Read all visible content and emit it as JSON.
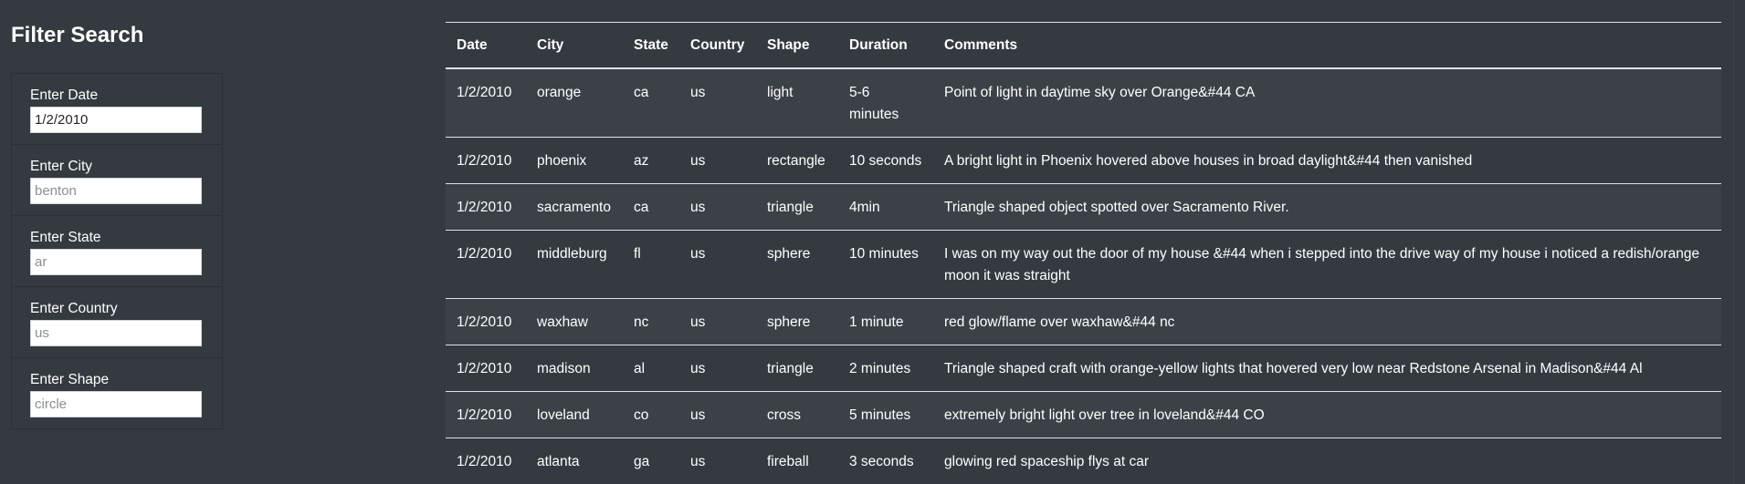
{
  "sidebar": {
    "title": "Filter Search",
    "filters": [
      {
        "label": "Enter Date",
        "value": "1/2/2010",
        "placeholder": ""
      },
      {
        "label": "Enter City",
        "value": "",
        "placeholder": "benton"
      },
      {
        "label": "Enter State",
        "value": "",
        "placeholder": "ar"
      },
      {
        "label": "Enter Country",
        "value": "",
        "placeholder": "us"
      },
      {
        "label": "Enter Shape",
        "value": "",
        "placeholder": "circle"
      }
    ]
  },
  "table": {
    "headers": [
      "Date",
      "City",
      "State",
      "Country",
      "Shape",
      "Duration",
      "Comments"
    ],
    "rows": [
      [
        "1/2/2010",
        "orange",
        "ca",
        "us",
        "light",
        "5-6 minutes",
        "Point of light in daytime sky over Orange&#44 CA"
      ],
      [
        "1/2/2010",
        "phoenix",
        "az",
        "us",
        "rectangle",
        "10 seconds",
        "A bright light in Phoenix hovered above houses in broad daylight&#44 then vanished"
      ],
      [
        "1/2/2010",
        "sacramento",
        "ca",
        "us",
        "triangle",
        "4min",
        "Triangle shaped object spotted over Sacramento River."
      ],
      [
        "1/2/2010",
        "middleburg",
        "fl",
        "us",
        "sphere",
        "10 minutes",
        "I was on my way out the door of my house &#44 when i stepped into the drive way of my house i noticed a redish/orange moon it was straight"
      ],
      [
        "1/2/2010",
        "waxhaw",
        "nc",
        "us",
        "sphere",
        "1 minute",
        "red glow/flame over waxhaw&#44 nc"
      ],
      [
        "1/2/2010",
        "madison",
        "al",
        "us",
        "triangle",
        "2 minutes",
        "Triangle shaped craft with orange-yellow lights that hovered very low near Redstone Arsenal in Madison&#44 Al"
      ],
      [
        "1/2/2010",
        "loveland",
        "co",
        "us",
        "cross",
        "5 minutes",
        "extremely bright light over tree in loveland&#44 CO"
      ],
      [
        "1/2/2010",
        "atlanta",
        "ga",
        "us",
        "fireball",
        "3 seconds",
        "glowing red spaceship flys at car"
      ]
    ]
  }
}
